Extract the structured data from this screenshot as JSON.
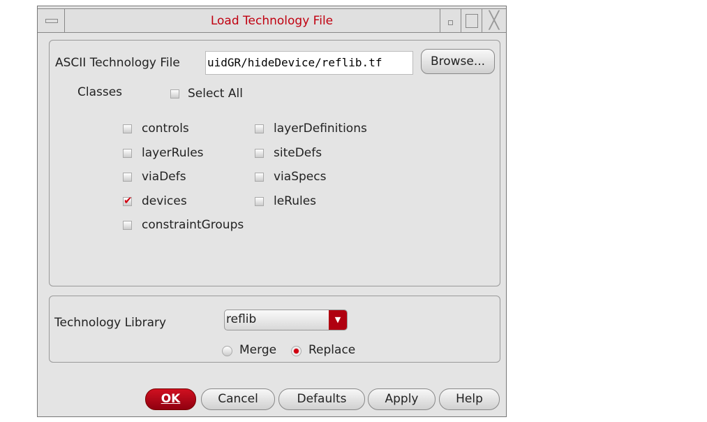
{
  "window": {
    "title": "Load Technology File"
  },
  "file": {
    "label": "ASCII Technology File",
    "value": "uidGR/hideDevice/reflib.tf",
    "browse": "Browse..."
  },
  "classes": {
    "label": "Classes",
    "select_all": "Select All",
    "items": [
      {
        "label": "controls",
        "checked": false
      },
      {
        "label": "layerDefinitions",
        "checked": false
      },
      {
        "label": "layerRules",
        "checked": false
      },
      {
        "label": "siteDefs",
        "checked": false
      },
      {
        "label": "viaDefs",
        "checked": false
      },
      {
        "label": "viaSpecs",
        "checked": false
      },
      {
        "label": "devices",
        "checked": true
      },
      {
        "label": "leRules",
        "checked": false
      },
      {
        "label": "constraintGroups",
        "checked": false
      }
    ]
  },
  "library": {
    "label": "Technology Library",
    "value": "reflib",
    "merge": "Merge",
    "replace": "Replace",
    "selected": "Replace"
  },
  "buttons": {
    "ok": "OK",
    "cancel": "Cancel",
    "defaults": "Defaults",
    "apply": "Apply",
    "help": "Help"
  },
  "colors": {
    "accent": "#c00010"
  }
}
